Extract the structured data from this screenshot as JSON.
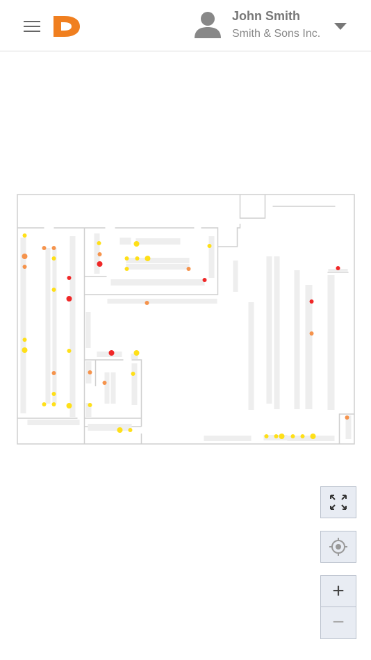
{
  "header": {
    "menu_icon": "hamburger-icon",
    "logo_letter": "D",
    "brand_color": "#f07f1f",
    "user_name": "John Smith",
    "company": "Smith & Sons Inc.",
    "avatar_icon": "user-icon",
    "dropdown_icon": "caret-down-icon"
  },
  "map": {
    "marker_colors": {
      "red": "#ee1111",
      "orange": "#f5883a",
      "yellow": "#ffdd00"
    },
    "controls": {
      "fullscreen_icon": "expand-icon",
      "locate_icon": "crosshair-icon",
      "zoom_in_label": "+",
      "zoom_out_label": "−"
    }
  }
}
